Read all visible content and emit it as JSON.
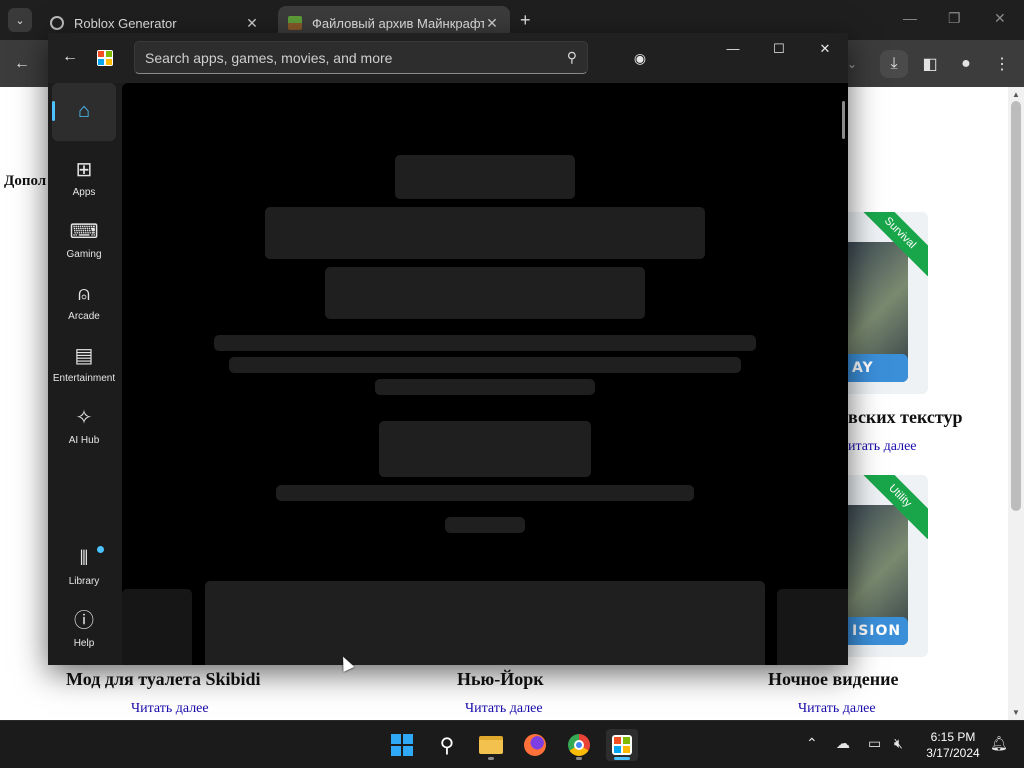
{
  "browser": {
    "tabs": [
      {
        "title": "Roblox Generator",
        "close": "✕"
      },
      {
        "title": "Файловый архив Майнкрафта",
        "close": "✕"
      }
    ],
    "new_tab": "+",
    "win_controls": {
      "minimize": "—",
      "maximize": "❐",
      "close": "✕"
    },
    "toolbar_icons": [
      "back-arrow-icon",
      "download-icon",
      "side-panel-icon",
      "profile-icon",
      "more-menu-icon"
    ]
  },
  "webpage": {
    "section_label": "Допол",
    "partial_titles": [
      "вских текстур"
    ],
    "read_more_top": "итать далее",
    "thumb_ribbons": [
      "Survival",
      "Utility"
    ],
    "thumb_banners": [
      "AY",
      "ISION"
    ],
    "cards": [
      {
        "title": "Мод для туалета Skibidi",
        "link": "Читать далее"
      },
      {
        "title": "Нью-Йорк",
        "link": "Читать далее"
      },
      {
        "title": "Ночное видение",
        "link": "Читать далее"
      }
    ]
  },
  "store": {
    "search_placeholder": "Search apps, games, movies, and more",
    "win_controls": {
      "minimize": "—",
      "maximize": "☐",
      "close": "✕"
    },
    "nav": [
      {
        "label": "",
        "icon": "home-icon"
      },
      {
        "label": "Apps",
        "icon": "apps-icon"
      },
      {
        "label": "Gaming",
        "icon": "gamepad-icon"
      },
      {
        "label": "Arcade",
        "icon": "joystick-icon"
      },
      {
        "label": "Entertainment",
        "icon": "clapperboard-icon"
      },
      {
        "label": "AI Hub",
        "icon": "sparkle-icon"
      },
      {
        "label": "Library",
        "icon": "library-icon"
      },
      {
        "label": "Help",
        "icon": "help-icon"
      }
    ]
  },
  "taskbar": {
    "apps": [
      "start-icon",
      "search-icon",
      "file-explorer-icon",
      "firefox-icon",
      "chrome-icon",
      "microsoft-store-icon"
    ],
    "time": "6:15 PM",
    "date": "3/17/2024",
    "accent": "#4cc2ff"
  }
}
